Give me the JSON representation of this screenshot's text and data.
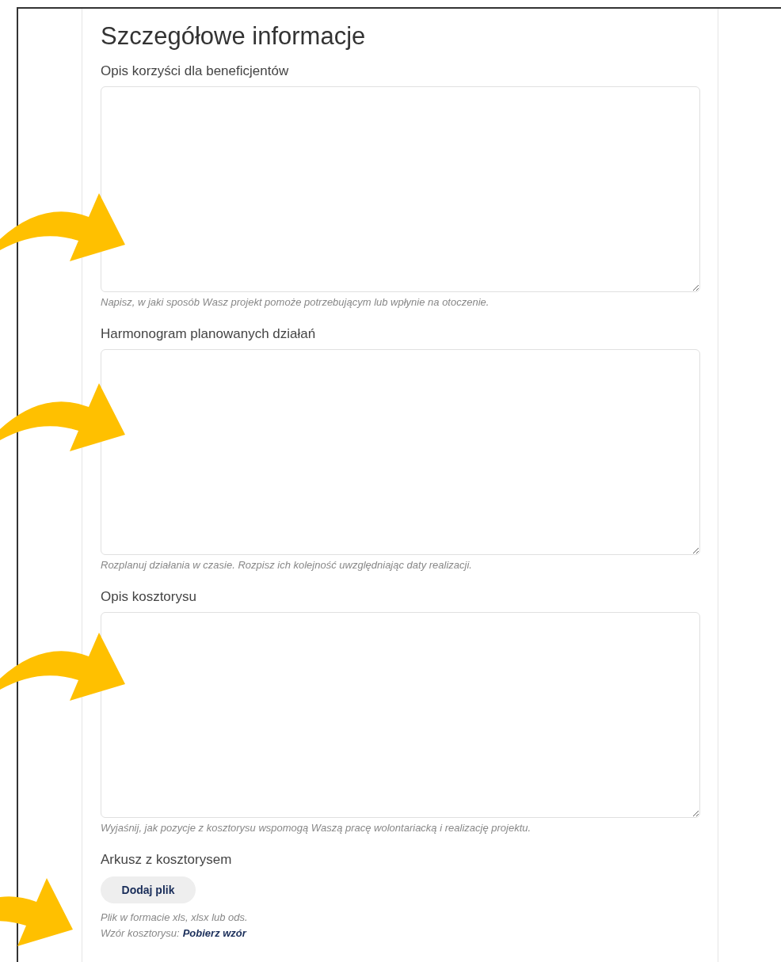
{
  "title": "Szczegółowe informacje",
  "fields": [
    {
      "kind": "textarea",
      "label": "Opis korzyści dla beneficjentów",
      "hint": "Napisz, w jaki sposób Wasz projekt pomoże potrzebującym lub wpłynie na otoczenie."
    },
    {
      "kind": "textarea",
      "label": "Harmonogram planowanych działań",
      "hint": "Rozplanuj działania w czasie. Rozpisz ich kolejność uwzględniając daty realizacji."
    },
    {
      "kind": "textarea",
      "label": "Opis kosztorysu",
      "hint": "Wyjaśnij, jak pozycje z kosztorysu wspomogą Waszą pracę wolontariacką i realizację projektu."
    },
    {
      "kind": "file",
      "label": "Arkusz z kosztorysem",
      "button": "Dodaj plik",
      "hint": "Plik w formacie xls, xlsx lub ods.",
      "template_label": "Wzór kosztorysu:",
      "template_link": "Pobierz wzór"
    }
  ]
}
